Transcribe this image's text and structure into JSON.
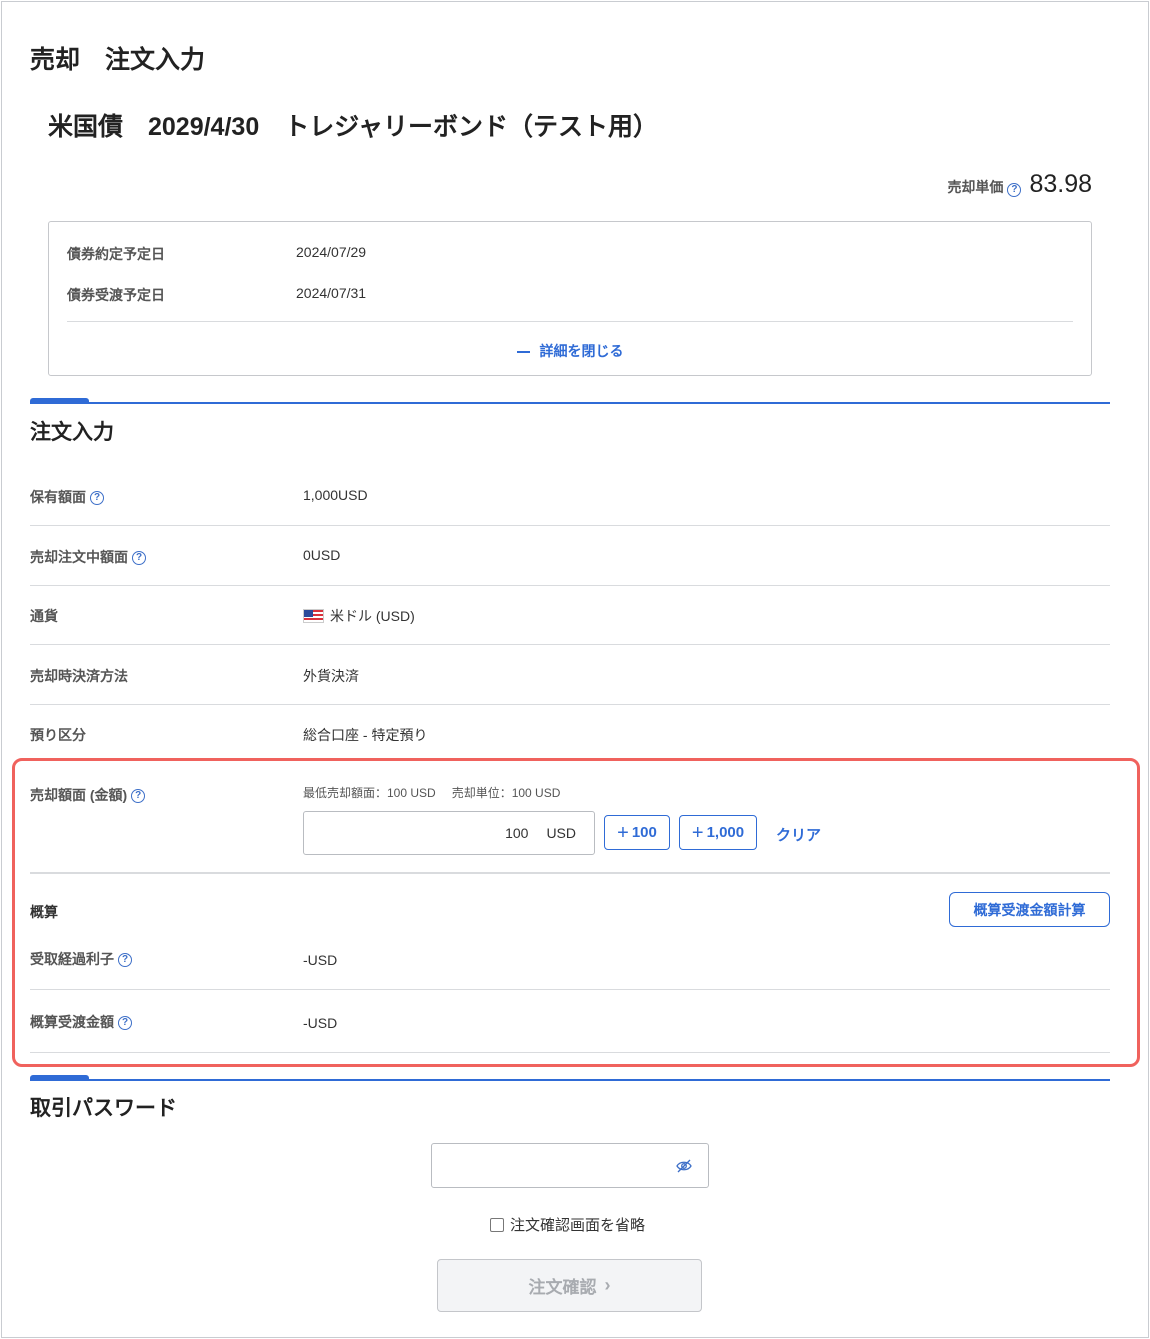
{
  "page": {
    "title": "売却　注文入力",
    "bond_name": "米国債　2029/4/30　トレジャリーボンド（テスト用）",
    "unit_price_label": "売却単価",
    "unit_price_value": "83.98"
  },
  "details": {
    "rows": [
      {
        "label": "債券約定予定日",
        "value": "2024/07/29"
      },
      {
        "label": "債券受渡予定日",
        "value": "2024/07/31"
      }
    ],
    "close_label": "詳細を閉じる"
  },
  "order": {
    "section_title": "注文入力",
    "rows": [
      {
        "label": "保有額面",
        "value": "1,000USD",
        "help": true
      },
      {
        "label": "売却注文中額面",
        "value": "0USD",
        "help": true
      },
      {
        "label": "通貨",
        "value": "米ドル (USD)",
        "help": false,
        "flag": "us-flag"
      },
      {
        "label": "売却時決済方法",
        "value": "外貨決済",
        "help": false
      },
      {
        "label": "預り区分",
        "value": "総合口座 - 特定預り",
        "help": false
      }
    ],
    "amount": {
      "label": "売却額面 (金額)",
      "min_hint": "最低売却額面：100 USD",
      "unit_hint": "売却単位：100 USD",
      "value": "100",
      "unit": "USD",
      "btn_plus_100": "100",
      "btn_plus_1000": "1,000",
      "clear": "クリア"
    },
    "estimate": {
      "title": "概算",
      "calc_button": "概算受渡金額計算",
      "rows": [
        {
          "label": "受取経過利子",
          "value": "-USD"
        },
        {
          "label": "概算受渡金額",
          "value": "-USD"
        }
      ]
    }
  },
  "password": {
    "section_title": "取引パスワード",
    "skip_label": "注文確認画面を省略",
    "confirm_button": "注文確認"
  },
  "colors": {
    "accent": "#2f6bd6",
    "highlight": "#f0625d"
  }
}
